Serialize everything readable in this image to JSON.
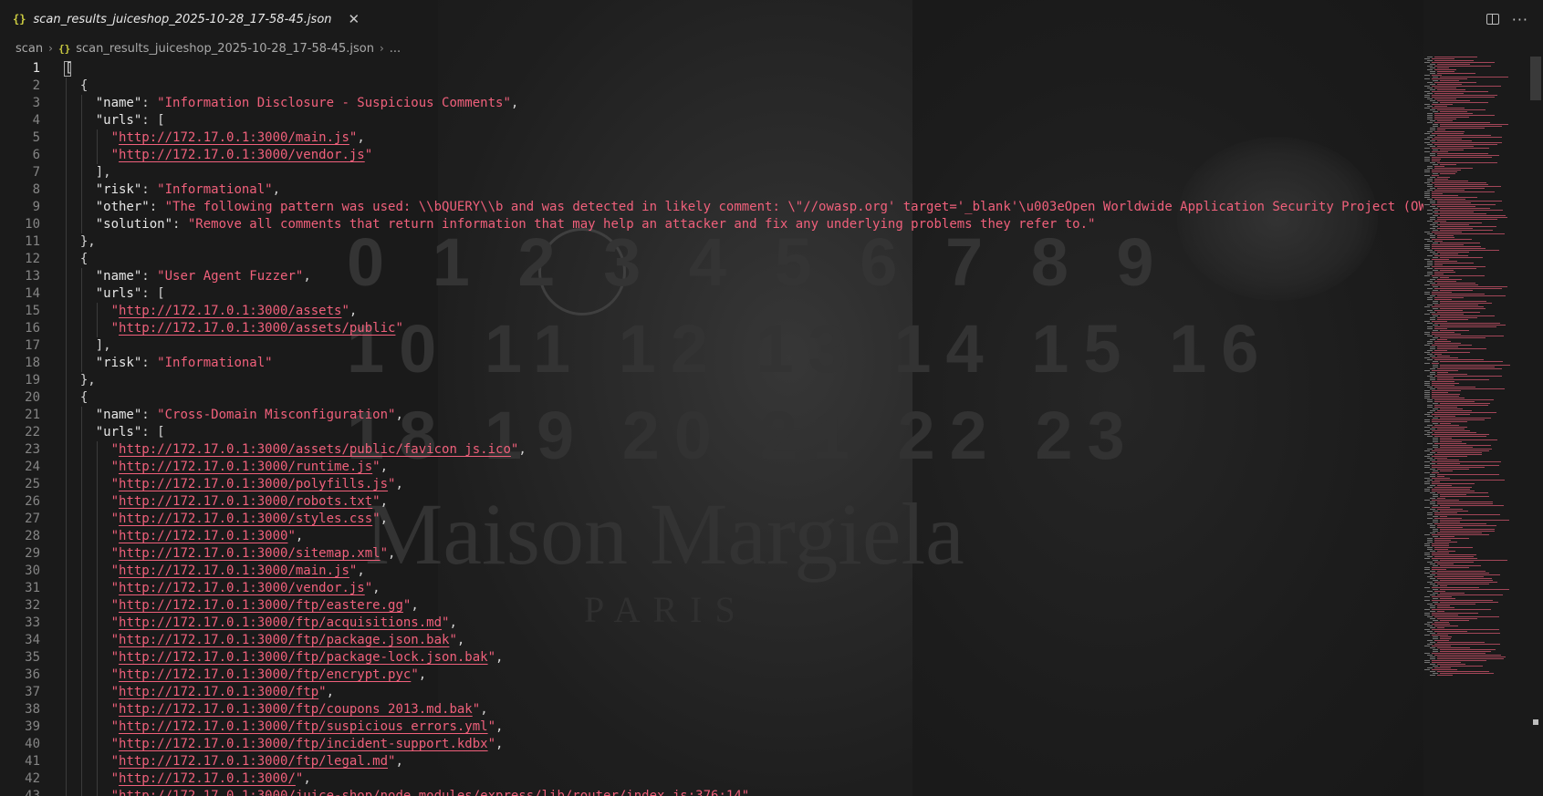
{
  "tab": {
    "title": "scan_results_juiceshop_2025-10-28_17-58-45.json",
    "icon": "{}"
  },
  "breadcrumb": {
    "folder": "scan",
    "file": "scan_results_juiceshop_2025-10-28_17-58-45.json",
    "ellipsis": "..."
  },
  "editor": {
    "active_line": 1,
    "lines": [
      {
        "n": "1",
        "segs": [
          {
            "t": "[",
            "c": "p"
          }
        ]
      },
      {
        "n": "2",
        "segs": [
          {
            "t": "  {",
            "c": "p"
          }
        ]
      },
      {
        "n": "3",
        "segs": [
          {
            "t": "    ",
            "c": "p"
          },
          {
            "t": "\"name\"",
            "c": "k"
          },
          {
            "t": ": ",
            "c": "p"
          },
          {
            "t": "\"Information Disclosure - Suspicious Comments\"",
            "c": "s"
          },
          {
            "t": ",",
            "c": "p"
          }
        ]
      },
      {
        "n": "4",
        "segs": [
          {
            "t": "    ",
            "c": "p"
          },
          {
            "t": "\"urls\"",
            "c": "k"
          },
          {
            "t": ": [",
            "c": "p"
          }
        ]
      },
      {
        "n": "5",
        "segs": [
          {
            "t": "      ",
            "c": "p"
          },
          {
            "t": "\"",
            "c": "s"
          },
          {
            "t": "http://172.17.0.1:3000/main.js",
            "c": "u"
          },
          {
            "t": "\"",
            "c": "s"
          },
          {
            "t": ",",
            "c": "p"
          }
        ]
      },
      {
        "n": "6",
        "segs": [
          {
            "t": "      ",
            "c": "p"
          },
          {
            "t": "\"",
            "c": "s"
          },
          {
            "t": "http://172.17.0.1:3000/vendor.js",
            "c": "u"
          },
          {
            "t": "\"",
            "c": "s"
          }
        ]
      },
      {
        "n": "7",
        "segs": [
          {
            "t": "    ],",
            "c": "p"
          }
        ]
      },
      {
        "n": "8",
        "segs": [
          {
            "t": "    ",
            "c": "p"
          },
          {
            "t": "\"risk\"",
            "c": "k"
          },
          {
            "t": ": ",
            "c": "p"
          },
          {
            "t": "\"Informational\"",
            "c": "s"
          },
          {
            "t": ",",
            "c": "p"
          }
        ]
      },
      {
        "n": "9",
        "segs": [
          {
            "t": "    ",
            "c": "p"
          },
          {
            "t": "\"other\"",
            "c": "k"
          },
          {
            "t": ": ",
            "c": "p"
          },
          {
            "t": "\"The following pattern was used: \\\\bQUERY\\\\b and was detected in likely comment: \\\"//owasp.org' target='_blank'\\u003eOpen Worldwide Application Security Project (OW",
            "c": "s"
          }
        ]
      },
      {
        "n": "10",
        "segs": [
          {
            "t": "    ",
            "c": "p"
          },
          {
            "t": "\"solution\"",
            "c": "k"
          },
          {
            "t": ": ",
            "c": "p"
          },
          {
            "t": "\"Remove all comments that return information that may help an attacker and fix any underlying problems they refer to.\"",
            "c": "s"
          }
        ]
      },
      {
        "n": "11",
        "segs": [
          {
            "t": "  },",
            "c": "p"
          }
        ]
      },
      {
        "n": "12",
        "segs": [
          {
            "t": "  {",
            "c": "p"
          }
        ]
      },
      {
        "n": "13",
        "segs": [
          {
            "t": "    ",
            "c": "p"
          },
          {
            "t": "\"name\"",
            "c": "k"
          },
          {
            "t": ": ",
            "c": "p"
          },
          {
            "t": "\"User Agent Fuzzer\"",
            "c": "s"
          },
          {
            "t": ",",
            "c": "p"
          }
        ]
      },
      {
        "n": "14",
        "segs": [
          {
            "t": "    ",
            "c": "p"
          },
          {
            "t": "\"urls\"",
            "c": "k"
          },
          {
            "t": ": [",
            "c": "p"
          }
        ]
      },
      {
        "n": "15",
        "segs": [
          {
            "t": "      ",
            "c": "p"
          },
          {
            "t": "\"",
            "c": "s"
          },
          {
            "t": "http://172.17.0.1:3000/assets",
            "c": "u"
          },
          {
            "t": "\"",
            "c": "s"
          },
          {
            "t": ",",
            "c": "p"
          }
        ]
      },
      {
        "n": "16",
        "segs": [
          {
            "t": "      ",
            "c": "p"
          },
          {
            "t": "\"",
            "c": "s"
          },
          {
            "t": "http://172.17.0.1:3000/assets/public",
            "c": "u"
          },
          {
            "t": "\"",
            "c": "s"
          }
        ]
      },
      {
        "n": "17",
        "segs": [
          {
            "t": "    ],",
            "c": "p"
          }
        ]
      },
      {
        "n": "18",
        "segs": [
          {
            "t": "    ",
            "c": "p"
          },
          {
            "t": "\"risk\"",
            "c": "k"
          },
          {
            "t": ": ",
            "c": "p"
          },
          {
            "t": "\"Informational\"",
            "c": "s"
          }
        ]
      },
      {
        "n": "19",
        "segs": [
          {
            "t": "  },",
            "c": "p"
          }
        ]
      },
      {
        "n": "20",
        "segs": [
          {
            "t": "  {",
            "c": "p"
          }
        ]
      },
      {
        "n": "21",
        "segs": [
          {
            "t": "    ",
            "c": "p"
          },
          {
            "t": "\"name\"",
            "c": "k"
          },
          {
            "t": ": ",
            "c": "p"
          },
          {
            "t": "\"Cross-Domain Misconfiguration\"",
            "c": "s"
          },
          {
            "t": ",",
            "c": "p"
          }
        ]
      },
      {
        "n": "22",
        "segs": [
          {
            "t": "    ",
            "c": "p"
          },
          {
            "t": "\"urls\"",
            "c": "k"
          },
          {
            "t": ": [",
            "c": "p"
          }
        ]
      },
      {
        "n": "23",
        "segs": [
          {
            "t": "      ",
            "c": "p"
          },
          {
            "t": "\"",
            "c": "s"
          },
          {
            "t": "http://172.17.0.1:3000/assets/public/favicon_js.ico",
            "c": "u"
          },
          {
            "t": "\"",
            "c": "s"
          },
          {
            "t": ",",
            "c": "p"
          }
        ]
      },
      {
        "n": "24",
        "segs": [
          {
            "t": "      ",
            "c": "p"
          },
          {
            "t": "\"",
            "c": "s"
          },
          {
            "t": "http://172.17.0.1:3000/runtime.js",
            "c": "u"
          },
          {
            "t": "\"",
            "c": "s"
          },
          {
            "t": ",",
            "c": "p"
          }
        ]
      },
      {
        "n": "25",
        "segs": [
          {
            "t": "      ",
            "c": "p"
          },
          {
            "t": "\"",
            "c": "s"
          },
          {
            "t": "http://172.17.0.1:3000/polyfills.js",
            "c": "u"
          },
          {
            "t": "\"",
            "c": "s"
          },
          {
            "t": ",",
            "c": "p"
          }
        ]
      },
      {
        "n": "26",
        "segs": [
          {
            "t": "      ",
            "c": "p"
          },
          {
            "t": "\"",
            "c": "s"
          },
          {
            "t": "http://172.17.0.1:3000/robots.txt",
            "c": "u"
          },
          {
            "t": "\"",
            "c": "s"
          },
          {
            "t": ",",
            "c": "p"
          }
        ]
      },
      {
        "n": "27",
        "segs": [
          {
            "t": "      ",
            "c": "p"
          },
          {
            "t": "\"",
            "c": "s"
          },
          {
            "t": "http://172.17.0.1:3000/styles.css",
            "c": "u"
          },
          {
            "t": "\"",
            "c": "s"
          },
          {
            "t": ",",
            "c": "p"
          }
        ]
      },
      {
        "n": "28",
        "segs": [
          {
            "t": "      ",
            "c": "p"
          },
          {
            "t": "\"",
            "c": "s"
          },
          {
            "t": "http://172.17.0.1:3000",
            "c": "u"
          },
          {
            "t": "\"",
            "c": "s"
          },
          {
            "t": ",",
            "c": "p"
          }
        ]
      },
      {
        "n": "29",
        "segs": [
          {
            "t": "      ",
            "c": "p"
          },
          {
            "t": "\"",
            "c": "s"
          },
          {
            "t": "http://172.17.0.1:3000/sitemap.xml",
            "c": "u"
          },
          {
            "t": "\"",
            "c": "s"
          },
          {
            "t": ",",
            "c": "p"
          }
        ]
      },
      {
        "n": "30",
        "segs": [
          {
            "t": "      ",
            "c": "p"
          },
          {
            "t": "\"",
            "c": "s"
          },
          {
            "t": "http://172.17.0.1:3000/main.js",
            "c": "u"
          },
          {
            "t": "\"",
            "c": "s"
          },
          {
            "t": ",",
            "c": "p"
          }
        ]
      },
      {
        "n": "31",
        "segs": [
          {
            "t": "      ",
            "c": "p"
          },
          {
            "t": "\"",
            "c": "s"
          },
          {
            "t": "http://172.17.0.1:3000/vendor.js",
            "c": "u"
          },
          {
            "t": "\"",
            "c": "s"
          },
          {
            "t": ",",
            "c": "p"
          }
        ]
      },
      {
        "n": "32",
        "segs": [
          {
            "t": "      ",
            "c": "p"
          },
          {
            "t": "\"",
            "c": "s"
          },
          {
            "t": "http://172.17.0.1:3000/ftp/eastere.gg",
            "c": "u"
          },
          {
            "t": "\"",
            "c": "s"
          },
          {
            "t": ",",
            "c": "p"
          }
        ]
      },
      {
        "n": "33",
        "segs": [
          {
            "t": "      ",
            "c": "p"
          },
          {
            "t": "\"",
            "c": "s"
          },
          {
            "t": "http://172.17.0.1:3000/ftp/acquisitions.md",
            "c": "u"
          },
          {
            "t": "\"",
            "c": "s"
          },
          {
            "t": ",",
            "c": "p"
          }
        ]
      },
      {
        "n": "34",
        "segs": [
          {
            "t": "      ",
            "c": "p"
          },
          {
            "t": "\"",
            "c": "s"
          },
          {
            "t": "http://172.17.0.1:3000/ftp/package.json.bak",
            "c": "u"
          },
          {
            "t": "\"",
            "c": "s"
          },
          {
            "t": ",",
            "c": "p"
          }
        ]
      },
      {
        "n": "35",
        "segs": [
          {
            "t": "      ",
            "c": "p"
          },
          {
            "t": "\"",
            "c": "s"
          },
          {
            "t": "http://172.17.0.1:3000/ftp/package-lock.json.bak",
            "c": "u"
          },
          {
            "t": "\"",
            "c": "s"
          },
          {
            "t": ",",
            "c": "p"
          }
        ]
      },
      {
        "n": "36",
        "segs": [
          {
            "t": "      ",
            "c": "p"
          },
          {
            "t": "\"",
            "c": "s"
          },
          {
            "t": "http://172.17.0.1:3000/ftp/encrypt.pyc",
            "c": "u"
          },
          {
            "t": "\"",
            "c": "s"
          },
          {
            "t": ",",
            "c": "p"
          }
        ]
      },
      {
        "n": "37",
        "segs": [
          {
            "t": "      ",
            "c": "p"
          },
          {
            "t": "\"",
            "c": "s"
          },
          {
            "t": "http://172.17.0.1:3000/ftp",
            "c": "u"
          },
          {
            "t": "\"",
            "c": "s"
          },
          {
            "t": ",",
            "c": "p"
          }
        ]
      },
      {
        "n": "38",
        "segs": [
          {
            "t": "      ",
            "c": "p"
          },
          {
            "t": "\"",
            "c": "s"
          },
          {
            "t": "http://172.17.0.1:3000/ftp/coupons_2013.md.bak",
            "c": "u"
          },
          {
            "t": "\"",
            "c": "s"
          },
          {
            "t": ",",
            "c": "p"
          }
        ]
      },
      {
        "n": "39",
        "segs": [
          {
            "t": "      ",
            "c": "p"
          },
          {
            "t": "\"",
            "c": "s"
          },
          {
            "t": "http://172.17.0.1:3000/ftp/suspicious_errors.yml",
            "c": "u"
          },
          {
            "t": "\"",
            "c": "s"
          },
          {
            "t": ",",
            "c": "p"
          }
        ]
      },
      {
        "n": "40",
        "segs": [
          {
            "t": "      ",
            "c": "p"
          },
          {
            "t": "\"",
            "c": "s"
          },
          {
            "t": "http://172.17.0.1:3000/ftp/incident-support.kdbx",
            "c": "u"
          },
          {
            "t": "\"",
            "c": "s"
          },
          {
            "t": ",",
            "c": "p"
          }
        ]
      },
      {
        "n": "41",
        "segs": [
          {
            "t": "      ",
            "c": "p"
          },
          {
            "t": "\"",
            "c": "s"
          },
          {
            "t": "http://172.17.0.1:3000/ftp/legal.md",
            "c": "u"
          },
          {
            "t": "\"",
            "c": "s"
          },
          {
            "t": ",",
            "c": "p"
          }
        ]
      },
      {
        "n": "42",
        "segs": [
          {
            "t": "      ",
            "c": "p"
          },
          {
            "t": "\"",
            "c": "s"
          },
          {
            "t": "http://172.17.0.1:3000/",
            "c": "u"
          },
          {
            "t": "\"",
            "c": "s"
          },
          {
            "t": ",",
            "c": "p"
          }
        ]
      },
      {
        "n": "43",
        "segs": [
          {
            "t": "      ",
            "c": "p"
          },
          {
            "t": "\"",
            "c": "s"
          },
          {
            "t": "http://172.17.0.1:3000/juice-shop/node_modules/express/lib/router/index.js:376:14",
            "c": "u"
          },
          {
            "t": "\"",
            "c": "s"
          },
          {
            "t": ",",
            "c": "p"
          }
        ]
      }
    ]
  },
  "background": {
    "num_row_1": "0 1 2 3 4 5 6 7 8 9",
    "num_row_2": "10 11 12 13 14 15 16",
    "num_row_3": "18 19 20 21 22 23",
    "brand": "Maison Margiela",
    "city": "PARIS"
  },
  "icons": {
    "json": "json-file-icon",
    "close": "close-icon",
    "split": "split-editor-icon",
    "more": "more-actions-icon",
    "chevron": "chevron-right-icon"
  },
  "colors": {
    "string": "#f0607b",
    "key": "#e6e6e6",
    "line_number": "#858585",
    "json_icon": "#cbcb41"
  }
}
